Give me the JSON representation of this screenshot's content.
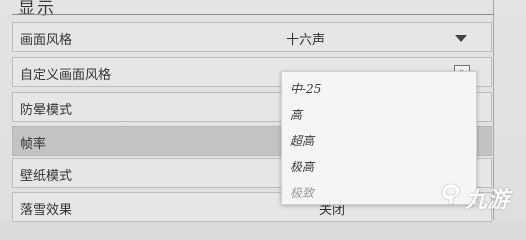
{
  "section": {
    "title": "显示"
  },
  "rows": [
    {
      "label": "画面风格",
      "value": "十六声"
    },
    {
      "label": "自定义画面风格",
      "button": "»"
    },
    {
      "label": "防晕模式"
    },
    {
      "label": "帧率"
    },
    {
      "label": "壁纸模式"
    },
    {
      "label": "落雪效果",
      "value": "关闭"
    }
  ],
  "dropdown": {
    "options": [
      {
        "label": "中-25",
        "disabled": false
      },
      {
        "label": "高",
        "disabled": false
      },
      {
        "label": "超高",
        "disabled": false
      },
      {
        "label": "极高",
        "disabled": false
      },
      {
        "label": "极致",
        "disabled": true
      }
    ]
  },
  "watermark": {
    "text": "九游"
  },
  "colors": {
    "highlight_row": "#c3c3c3",
    "panel": "#e3e3e3",
    "dropdown": "#f5f5f5"
  }
}
